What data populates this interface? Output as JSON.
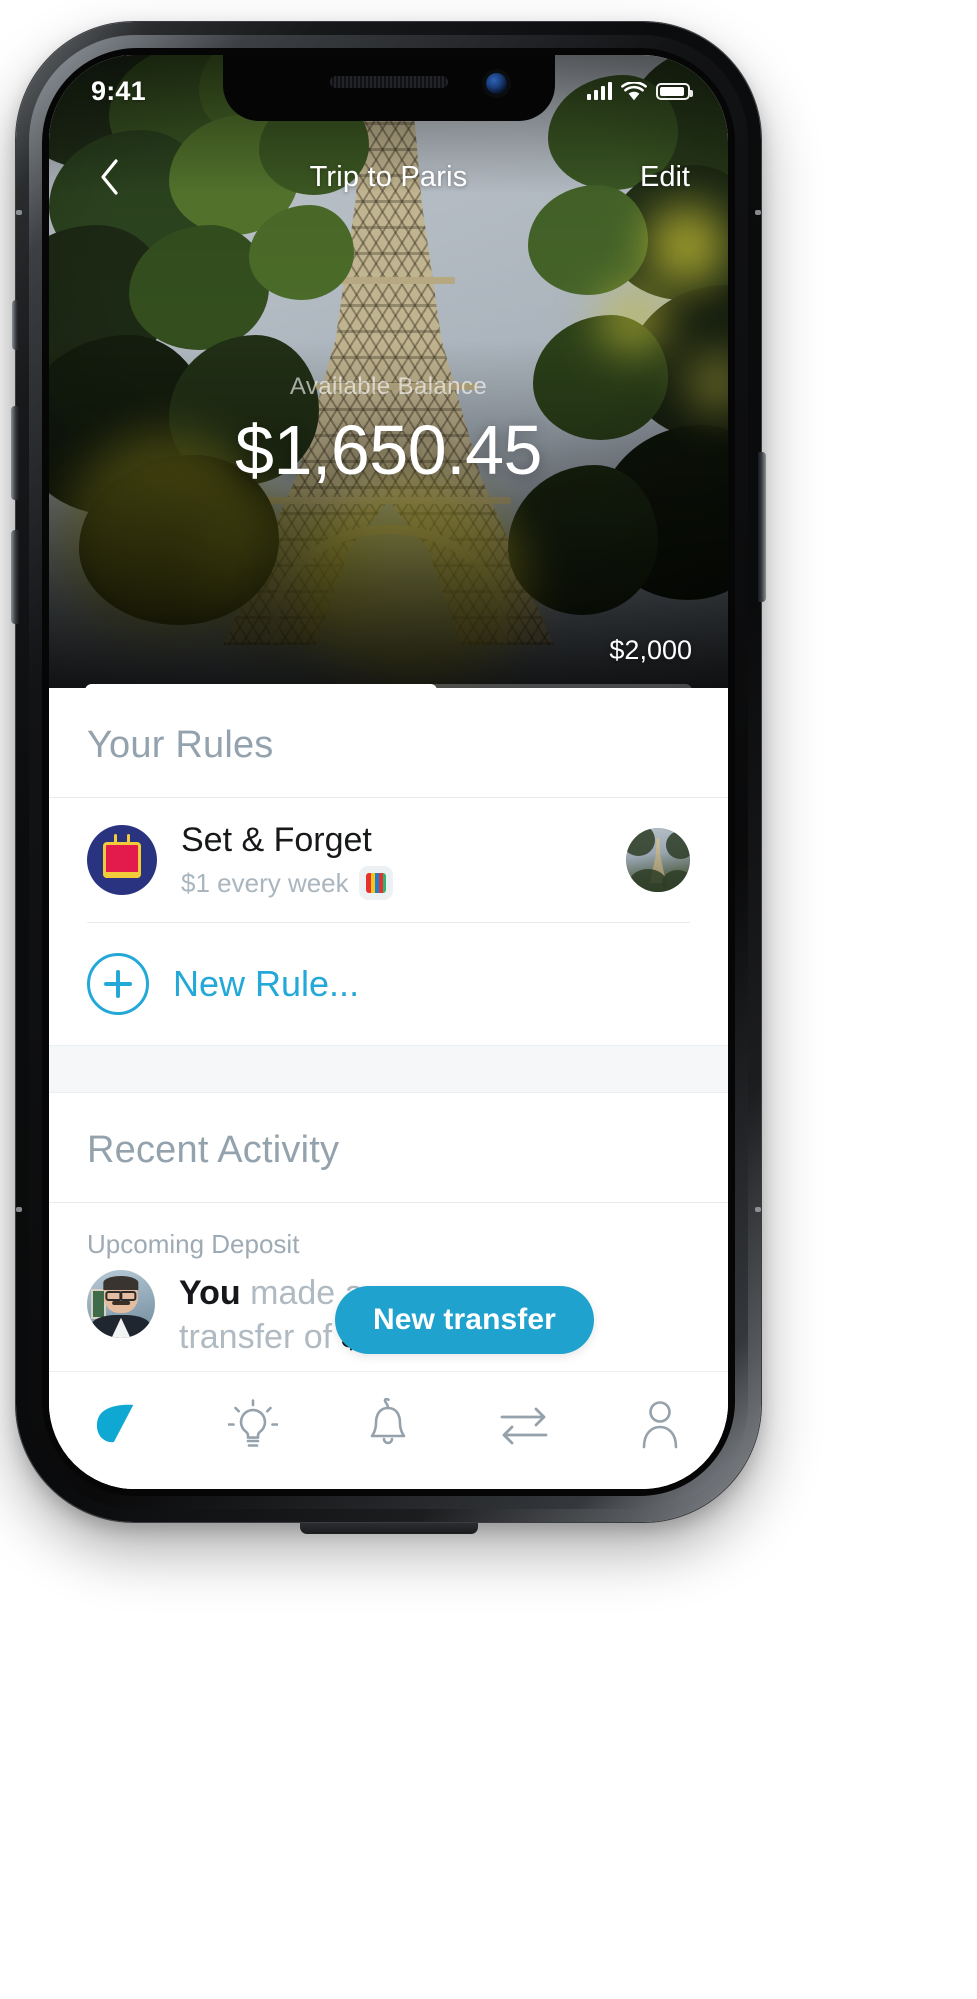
{
  "statusbar": {
    "time": "9:41",
    "signal_icon": "cellular-signal-icon",
    "wifi_icon": "wifi-icon",
    "battery_icon": "battery-icon"
  },
  "navbar": {
    "back_icon": "chevron-left-icon",
    "title": "Trip to Paris",
    "edit_label": "Edit"
  },
  "hero": {
    "balance_label": "Available Balance",
    "balance_amount": "$1,650.45",
    "goal_amount": "$2,000",
    "progress_percent": 58
  },
  "rules": {
    "section_title": "Your Rules",
    "items": [
      {
        "icon": "calendar-icon",
        "name": "Set & Forget",
        "subtitle": "$1 every week",
        "badge_icon": "artwork-badge-icon",
        "avatar": "trip-avatar"
      }
    ],
    "new_rule": {
      "icon": "plus-circle-icon",
      "label": "New Rule..."
    }
  },
  "activity": {
    "section_title": "Recent Activity",
    "items": [
      {
        "label": "Upcoming Deposit",
        "avatar": "user-avatar",
        "text_prefix": "You",
        "text_middle": " made a",
        "text_line2": "transfer of ",
        "amount": "$1."
      }
    ],
    "action_button": "New transfer"
  },
  "tabbar": {
    "items": [
      {
        "icon": "goals-leaf-icon",
        "active": true
      },
      {
        "icon": "lightbulb-icon",
        "active": false
      },
      {
        "icon": "bell-icon",
        "active": false
      },
      {
        "icon": "transfer-arrows-icon",
        "active": false
      },
      {
        "icon": "person-icon",
        "active": false
      }
    ]
  },
  "colors": {
    "accent": "#23a8d8",
    "pill": "#1fa2cd",
    "section_heading": "#93a2ad",
    "muted_text": "#aab6bf",
    "rule_icon_bg": "#2a3380"
  }
}
